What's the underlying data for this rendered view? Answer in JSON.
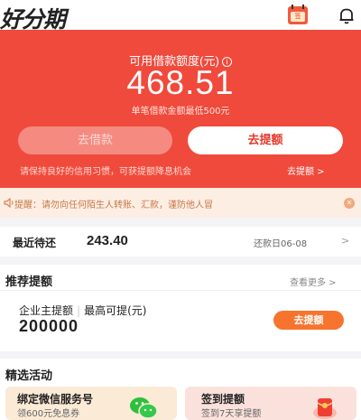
{
  "header": {
    "logo": "好分期",
    "sign_badge": "签"
  },
  "hero": {
    "label": "可用借款额度(元)",
    "info_glyph": "i",
    "amount": "468.51",
    "min_note": "单笔借款金额最低500元",
    "btn_loan": "去借款",
    "btn_raise": "去提额",
    "habit_text": "请保持良好的信用习惯，可获提额降息机会",
    "habit_link": "去提额 >"
  },
  "notice": {
    "text": "提醒：请勿向任何陌生人转账、汇款，谨防他人冒",
    "close": "✕"
  },
  "repay": {
    "label": "最近待还",
    "amount": "243.40",
    "date": "还款日06-08",
    "arrow": ">"
  },
  "recommend": {
    "title": "推荐提额",
    "more": "查看更多 >",
    "sub_left": "企业主提额",
    "sub_sep": "|",
    "sub_right": "最高可提(元)",
    "value": "200000",
    "button": "去提额"
  },
  "activities": {
    "title": "精选活动",
    "items": [
      {
        "name": "绑定微信服务号",
        "desc": "领600元免息券"
      },
      {
        "name": "签到提额",
        "desc": "签到7天享提额"
      }
    ]
  },
  "colors": {
    "brand_red": "#f04a3c",
    "orange": "#f7742e",
    "wechat_green": "#2ec03c"
  }
}
